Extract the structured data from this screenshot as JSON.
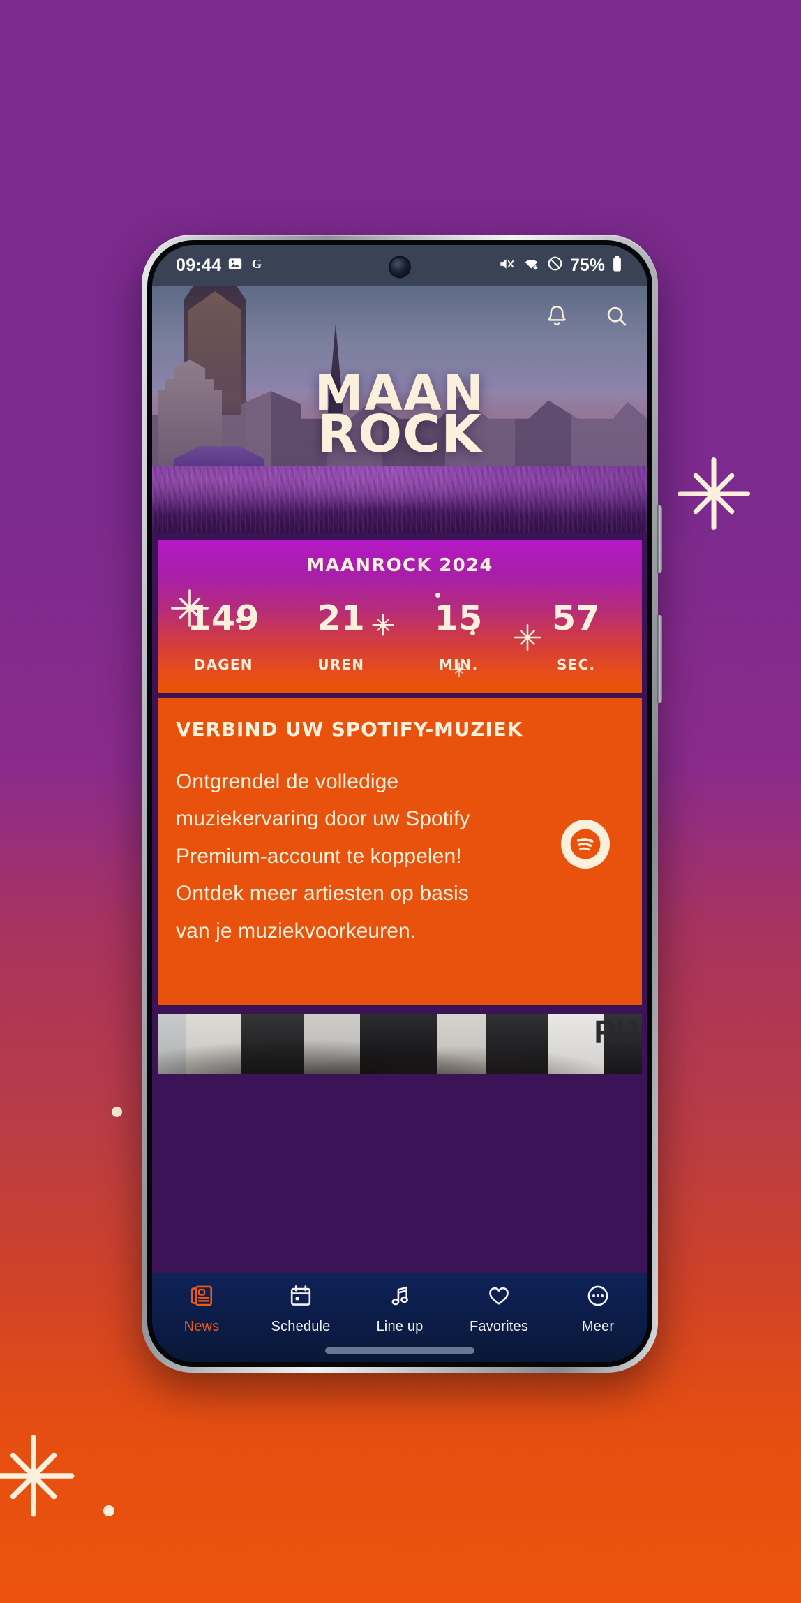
{
  "background": {
    "gradient_top": "#7B2A8D",
    "gradient_mid": "#B93C46",
    "gradient_bottom": "#EC530D",
    "accent_cream": "#FAF0DC"
  },
  "decor": {
    "star_right": "sparkle-star",
    "star_bottom_left": "sparkle-star",
    "dot_left": "dot",
    "dot_bottom": "dot"
  },
  "status_bar": {
    "time": "09:44",
    "battery_percent": "75%",
    "icons_left": [
      "image-icon",
      "google-icon"
    ],
    "icons_right": [
      "mute-icon",
      "wifi-icon",
      "do-not-disturb-icon",
      "battery-icon"
    ]
  },
  "hero": {
    "logo_line1": "MAAN",
    "logo_line2": "ROCK",
    "notifications_icon": "bell-icon",
    "search_icon": "search-icon",
    "image_alt": "Maanrock festival crowd at Grote Markt Mechelen with Sint-Romboutstoren"
  },
  "countdown": {
    "title": "MAANROCK 2024",
    "units": [
      {
        "value": "149",
        "label": "DAGEN"
      },
      {
        "value": "21",
        "label": "UREN"
      },
      {
        "value": "15",
        "label": "MIN."
      },
      {
        "value": "57",
        "label": "SEC."
      }
    ]
  },
  "spotify_card": {
    "title": "VERBIND UW SPOTIFY-MUZIEK",
    "body": "Ontgrendel de volledige muziekervaring door uw Spotify Premium-account te koppelen! Ontdek meer artiesten op basis van je muziekvoorkeuren.",
    "logo_icon": "spotify-icon",
    "background_color": "#E8520C"
  },
  "news_strip": {
    "image_alt": "Group of people in black tracksuits",
    "overlay_text": "RIJ"
  },
  "bottom_nav": {
    "active_color": "#EF5A12",
    "items": [
      {
        "label": "News",
        "icon": "newspaper-icon",
        "active": true
      },
      {
        "label": "Schedule",
        "icon": "calendar-icon",
        "active": false
      },
      {
        "label": "Line up",
        "icon": "music-note-icon",
        "active": false
      },
      {
        "label": "Favorites",
        "icon": "heart-icon",
        "active": false
      },
      {
        "label": "Meer",
        "icon": "more-dots-icon",
        "active": false
      }
    ]
  }
}
